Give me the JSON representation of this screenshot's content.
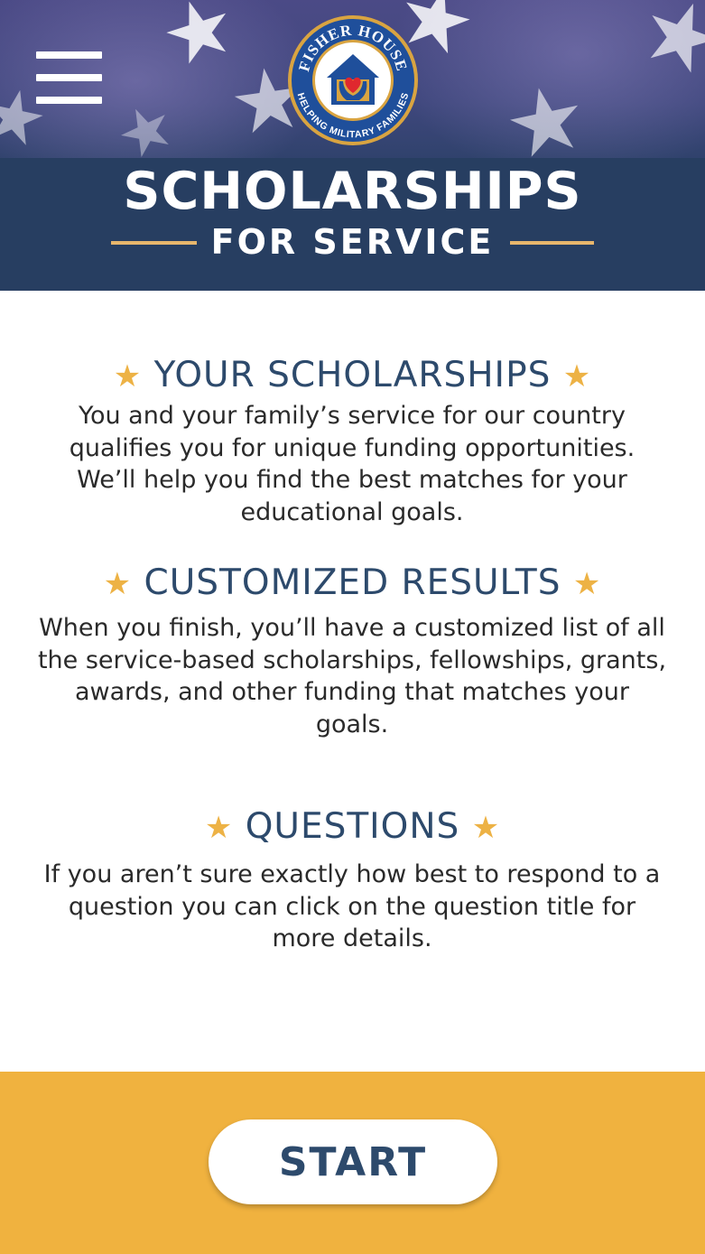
{
  "header": {
    "logo": {
      "top_text": "FISHER HOUSE",
      "bottom_text": "HELPING MILITARY FAMILIES",
      "colors": {
        "ring": "#1f4f9b",
        "gold": "#d9a441",
        "heart": "#e0282e"
      }
    },
    "title_main": "SCHOLARSHIPS",
    "title_sub": "FOR SERVICE",
    "menu_icon": "hamburger-menu-icon"
  },
  "sections": [
    {
      "title": "YOUR SCHOLARSHIPS",
      "body": "You and your family’s service for our country qualifies you for unique funding opportunities.  We’ll help you find the best matches for your educational goals."
    },
    {
      "title": "CUSTOMIZED RESULTS",
      "body": "When you finish, you’ll have a customized list of all the service-based scholarships, fellowships, grants, awards, and other funding that matches your goals."
    },
    {
      "title": "QUESTIONS",
      "body": "If you aren’t sure exactly how best to respond to a question you can click on the question title for more details."
    }
  ],
  "star_glyph": "★",
  "footer": {
    "start_label": "START"
  },
  "colors": {
    "navy": "#273e61",
    "gold": "#f0b23f",
    "star": "#edb245",
    "heading": "#2d4a6c"
  }
}
